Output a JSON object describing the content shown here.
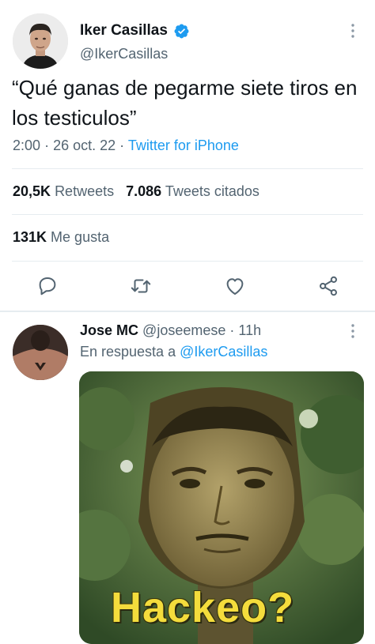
{
  "tweet": {
    "author_name": "Iker Casillas",
    "author_handle": "@IkerCasillas",
    "verified_icon": "verified-badge-icon",
    "text": "“Qué ganas de pegarme siete tiros en los testiculos”",
    "time": "2:00",
    "date": "26 oct. 22",
    "separator": "·",
    "source": "Twitter for iPhone",
    "retweets_count": "20,5K",
    "retweets_label": "Retweets",
    "quotes_count": "7.086",
    "quotes_label": "Tweets citados",
    "likes_count": "131K",
    "likes_label": "Me gusta",
    "actions": [
      "reply-icon",
      "retweet-icon",
      "like-icon",
      "share-icon"
    ]
  },
  "reply": {
    "author_name": "Jose MC",
    "author_handle": "@joseemese",
    "separator": "·",
    "time": "11h",
    "replying_prefix": "En respuesta a",
    "replying_to": "@IkerCasillas",
    "image_caption": "Hackeo?"
  },
  "colors": {
    "accent": "#1d9bf0",
    "secondary_text": "#536471",
    "primary_text": "#0f1419",
    "caption": "#f4dc3c"
  }
}
